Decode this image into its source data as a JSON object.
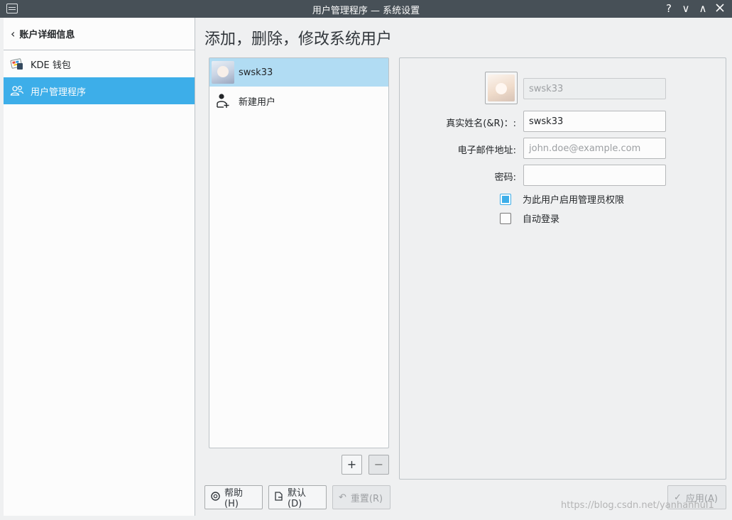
{
  "window": {
    "title": "用户管理程序 — 系统设置",
    "help_btn": "?",
    "minimize_btn": "∨",
    "maximize_btn": "∧"
  },
  "sidebar": {
    "header": "账户详细信息",
    "items": [
      {
        "label": "KDE 钱包",
        "icon": "kde-wallet-icon",
        "active": false
      },
      {
        "label": "用户管理程序",
        "icon": "users-icon",
        "active": true
      }
    ]
  },
  "main": {
    "title": "添加，删除，修改系统用户",
    "users": [
      {
        "name": "swsk33",
        "selected": true
      },
      {
        "name": "新建用户",
        "selected": false
      }
    ],
    "add_label": "+",
    "remove_label": "−",
    "details": {
      "username_value": "swsk33",
      "realname_label": "真实姓名(&R)：:",
      "realname_value": "swsk33",
      "email_label": "电子邮件地址:",
      "email_placeholder": "john.doe@example.com",
      "password_label": "密码:",
      "password_value": "",
      "admin_label": "为此用户启用管理员权限",
      "admin_checked": true,
      "autologin_label": "自动登录",
      "autologin_checked": false
    },
    "buttons": {
      "help": "帮助(H)",
      "defaults": "默认(D)",
      "reset": "重置(R)",
      "apply": "应用(A)"
    }
  },
  "watermark": "https://blog.csdn.net/yanhanhui1",
  "colors": {
    "accent": "#3daee9",
    "titlebar": "#475057",
    "selection": "#b1dcf3"
  }
}
